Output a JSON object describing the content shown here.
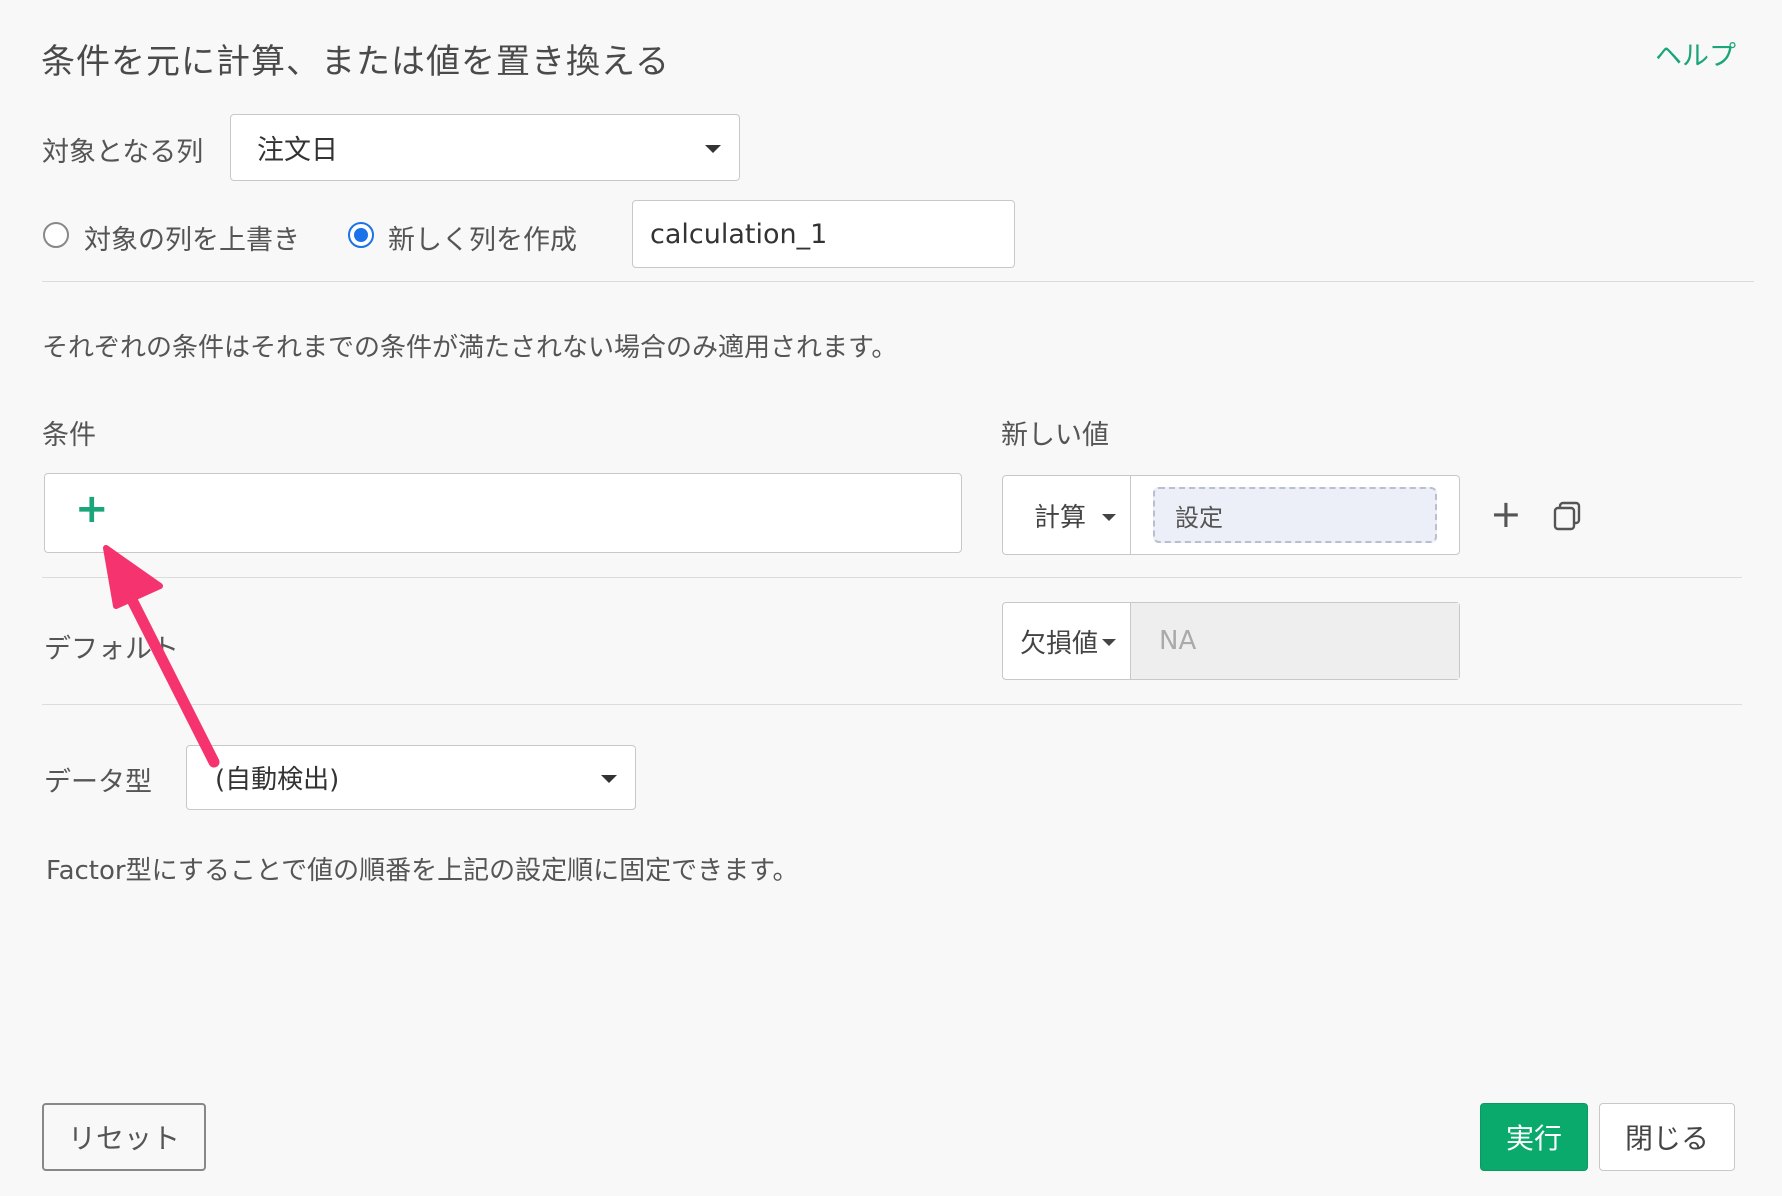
{
  "header": {
    "title": "条件を元に計算、または値を置き換える",
    "help_label": "ヘルプ"
  },
  "target_column": {
    "label": "対象となる列",
    "value": "注文日"
  },
  "mode": {
    "overwrite_label": "対象の列を上書き",
    "new_column_label": "新しく列を作成",
    "selected": "new_column",
    "new_column_name": "calculation_1"
  },
  "note": "それぞれの条件はそれまでの条件が満たされない場合のみ適用されます。",
  "conditions": {
    "header_condition": "条件",
    "header_new_value": "新しい値",
    "add_condition_symbol": "+",
    "value_type": "計算",
    "value_setting_label": "設定",
    "add_row_symbol": "+"
  },
  "default_row": {
    "label": "デフォルト",
    "type": "欠損値",
    "value": "NA"
  },
  "data_type": {
    "label": "データ型",
    "value": "(自動検出)"
  },
  "factor_note": "Factor型にすることで値の順番を上記の設定順に固定できます。",
  "footer": {
    "reset_label": "リセット",
    "run_label": "実行",
    "close_label": "閉じる"
  },
  "colors": {
    "accent_green": "#1aa57a",
    "run_button": "#0aa96c",
    "radio_blue": "#1a73e8",
    "arrow_pink": "#f5336f"
  }
}
